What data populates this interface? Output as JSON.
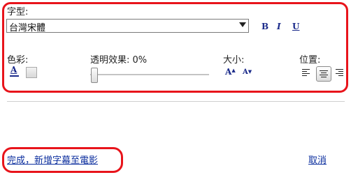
{
  "font": {
    "label": "字型:",
    "selected": "台灣宋體"
  },
  "format": {
    "bold": "B",
    "italic": "I",
    "underline": "U"
  },
  "color": {
    "label": "色彩:",
    "icon_letter": "A",
    "accent": "#1a2a8a"
  },
  "transparency": {
    "label": "透明效果: 0%",
    "value_percent": 0
  },
  "size": {
    "label": "大小:",
    "increase": "A",
    "decrease": "A"
  },
  "position": {
    "label": "位置:",
    "selected": "center",
    "options": [
      "left",
      "center",
      "right"
    ]
  },
  "actions": {
    "finish": "完成，新增字幕至電影",
    "cancel": "取消"
  },
  "highlight_color": "#e8141b"
}
